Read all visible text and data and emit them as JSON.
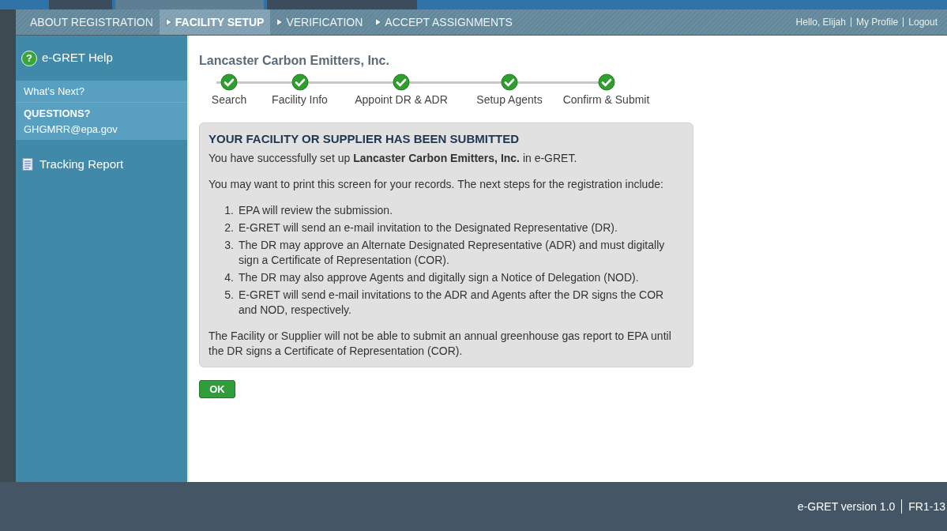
{
  "top_tabs": [
    {
      "selected": false
    },
    {
      "selected": true
    },
    {
      "selected": false
    }
  ],
  "subnav": [
    {
      "label": "ABOUT REGISTRATION",
      "selected": false,
      "arrow": false
    },
    {
      "label": "FACILITY SETUP",
      "selected": true,
      "arrow": true
    },
    {
      "label": "VERIFICATION",
      "selected": false,
      "arrow": true
    },
    {
      "label": "ACCEPT ASSIGNMENTS",
      "selected": false,
      "arrow": true
    }
  ],
  "user_links": [
    "Hello, Elijah",
    "My Profile",
    "Logout"
  ],
  "sidebar": {
    "help_glyph": "?",
    "help": "e-GRET Help",
    "whats_next": "What's Next?",
    "questions_label": "QUESTIONS?",
    "questions_email": "GHGMRR@epa.gov",
    "tracking": "Tracking Report"
  },
  "facility_name": "Lancaster Carbon Emitters, Inc.",
  "steps": [
    {
      "label": "Search",
      "done": true
    },
    {
      "label": "Facility Info",
      "done": true
    },
    {
      "label": "Appoint DR & ADR",
      "done": true
    },
    {
      "label": "Setup Agents",
      "done": true
    },
    {
      "label": "Confirm & Submit",
      "done": true
    }
  ],
  "panel": {
    "title": "YOUR FACILITY OR SUPPLIER HAS BEEN SUBMITTED",
    "intro": "You have successfully set up **Lancaster Carbon Emitters, Inc.** in e-GRET.",
    "print_note": "You may want to print this screen for your records. The next steps for the registration include:",
    "steps": [
      {
        "num": "1.",
        "text": "EPA will review the submission."
      },
      {
        "num": "2.",
        "text": "E-GRET will send an e-mail invitation to the Designated Representative (DR)."
      },
      {
        "num": "3.",
        "text": "The DR may approve an Alternate Designated Representative (ADR) and must digitally sign a Certificate of Representation (COR)."
      },
      {
        "num": "4.",
        "text": "The DR may also approve Agents and digitally sign a Notice of Delegation (NOD)."
      },
      {
        "num": "5.",
        "text": "E-GRET will send e-mail invitations to the ADR and Agents after the DR signs the COR and NOD, respectively."
      }
    ],
    "closing": "The Facility or Supplier will not be able to submit an annual greenhouse gas report to EPA until the DR signs a Certificate of Representation (COR)."
  },
  "ok_button": "OK",
  "footer": {
    "version": "e-GRET version 1.0",
    "code": "FR1-13"
  }
}
